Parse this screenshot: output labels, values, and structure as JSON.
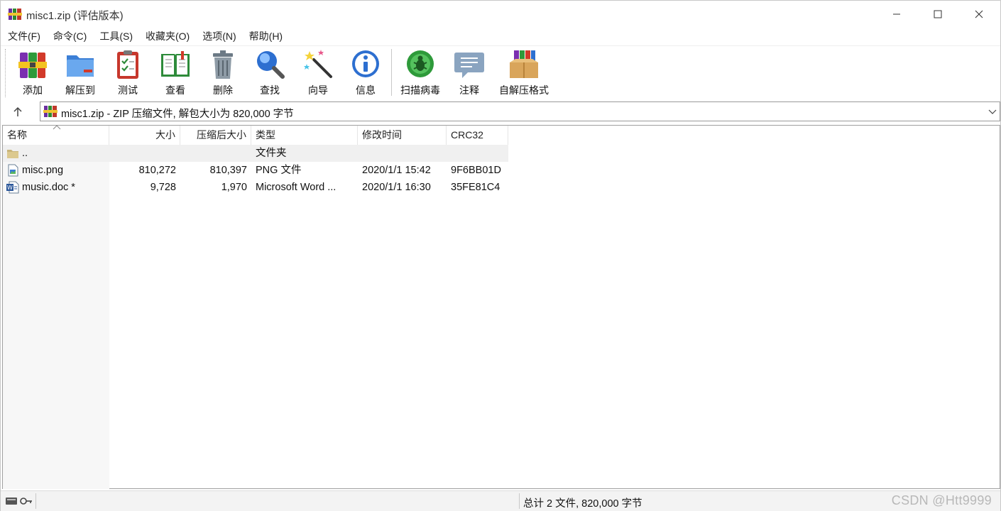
{
  "window": {
    "title": "misc1.zip (评估版本)"
  },
  "menu": [
    {
      "label": "文件(F)"
    },
    {
      "label": "命令(C)"
    },
    {
      "label": "工具(S)"
    },
    {
      "label": "收藏夹(O)"
    },
    {
      "label": "选项(N)"
    },
    {
      "label": "帮助(H)"
    }
  ],
  "toolbar": {
    "items": [
      {
        "label": "添加",
        "icon": "add-archive-icon"
      },
      {
        "label": "解压到",
        "icon": "extract-folder-icon"
      },
      {
        "label": "测试",
        "icon": "test-clipboard-icon"
      },
      {
        "label": "查看",
        "icon": "view-book-icon"
      },
      {
        "label": "删除",
        "icon": "trash-icon"
      },
      {
        "label": "查找",
        "icon": "magnifier-icon"
      },
      {
        "label": "向导",
        "icon": "wizard-wand-icon"
      },
      {
        "label": "信息",
        "icon": "info-icon"
      },
      {
        "label": "扫描病毒",
        "icon": "virus-scan-icon"
      },
      {
        "label": "注释",
        "icon": "comment-icon"
      },
      {
        "label": "自解压格式",
        "icon": "sfx-box-icon"
      }
    ]
  },
  "address": {
    "text": "misc1.zip - ZIP 压缩文件, 解包大小为 820,000 字节"
  },
  "table": {
    "columns": [
      "名称",
      "大小",
      "压缩后大小",
      "类型",
      "修改时间",
      "CRC32"
    ],
    "rows": [
      {
        "name": "..",
        "size": "",
        "packed": "",
        "type": "文件夹",
        "modified": "",
        "crc": "",
        "icon": "folder-icon"
      },
      {
        "name": "misc.png",
        "size": "810,272",
        "packed": "810,397",
        "type": "PNG 文件",
        "modified": "2020/1/1 15:42",
        "crc": "9F6BB01D",
        "icon": "image-file-icon"
      },
      {
        "name": "music.doc *",
        "size": "9,728",
        "packed": "1,970",
        "type": "Microsoft Word ...",
        "modified": "2020/1/1 16:30",
        "crc": "35FE81C4",
        "icon": "word-doc-icon"
      }
    ]
  },
  "status": {
    "total": "总计 2 文件, 820,000 字节",
    "watermark": "CSDN @Htt9999"
  },
  "colors": {
    "accent": "#1e73d8",
    "row_shade": "#f0f0f0",
    "status_bg": "#f3f3f3"
  }
}
